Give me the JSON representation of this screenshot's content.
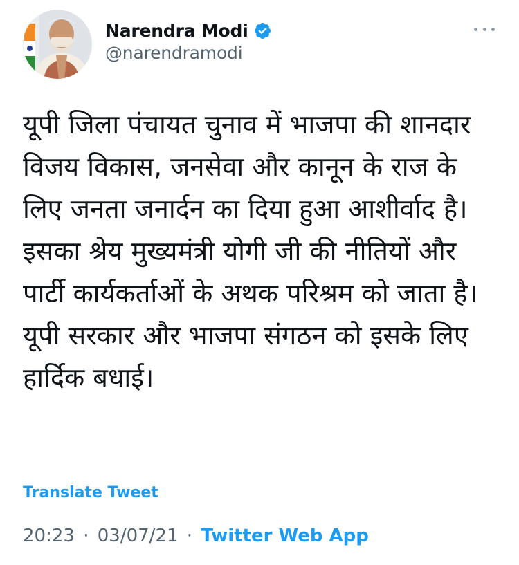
{
  "author": {
    "display_name": "Narendra Modi",
    "handle": "@narendramodi",
    "verified": true
  },
  "tweet": {
    "text": "यूपी जिला पंचायत चुनाव में भाजपा की शानदार विजय विकास, जनसेवा और कानून के राज के लिए जनता जनार्दन का दिया हुआ आशीर्वाद है।\nइसका श्रेय मुख्यमंत्री योगी जी की नीतियों और पार्टी कार्यकर्ताओं के अथक परिश्रम को जाता है। यूपी सरकार और भाजपा संगठन को इसके लिए हार्दिक बधाई।",
    "translate_label": "Translate Tweet",
    "time": "20:23",
    "date": "03/07/21",
    "source": "Twitter Web App",
    "separator": "·"
  },
  "icons": {
    "verified": "verified-badge-icon",
    "more": "more-options-icon"
  },
  "colors": {
    "accent": "#1d9bf0",
    "secondary_text": "#536471",
    "primary_text": "#0f1419",
    "more_dots": "#8b98a5"
  }
}
